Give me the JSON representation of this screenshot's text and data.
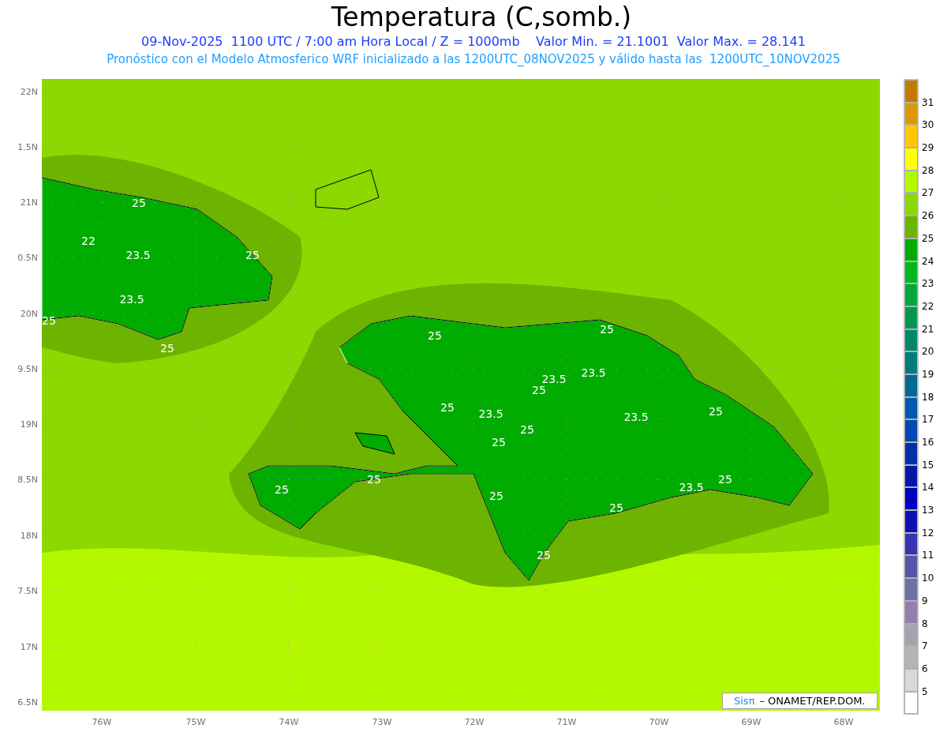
{
  "title": "Temperatura (C,somb.)",
  "subtitle": "09-Nov-2025  1100 UTC / 7:00 am Hora Local / Z = 1000mb    Valor Min. = 21.1001  Valor Max. = 28.141",
  "note": "Pronóstico con el Modelo Atmosferico WRF inicializado a las 1200UTC_08NOV2025 y válido hasta las  1200UTC_10NOV2025",
  "map": {
    "y_labels": [
      "22N",
      "1.5N",
      "21N",
      "0.5N",
      "20N",
      "9.5N",
      "19N",
      "8.5N",
      "18N",
      "7.5N",
      "17N",
      "6.5N"
    ],
    "x_labels": [
      "76W",
      "75W",
      "74W",
      "73W",
      "72W",
      "71W",
      "70W",
      "69W",
      "68W"
    ],
    "contour_labels": [
      "25",
      "22",
      "23.5",
      "25",
      "23.5",
      "25",
      "25",
      "25",
      "25",
      "23.5",
      "23.5",
      "25",
      "25",
      "23.5",
      "23.5",
      "25",
      "25",
      "25",
      "25",
      "25",
      "23.5",
      "25",
      "25",
      "25",
      "25"
    ]
  },
  "credit": {
    "brand": "Sisπ",
    "text": "– ONAMET/REP.DOM."
  },
  "colorbar": {
    "items": [
      {
        "color": "#c07c00"
      },
      {
        "label": "31",
        "color": "#e09800"
      },
      {
        "label": "30",
        "color": "#ffc800"
      },
      {
        "label": "29",
        "color": "#ffff00"
      },
      {
        "label": "28",
        "color": "#b4f800"
      },
      {
        "label": "27",
        "color": "#8cd800"
      },
      {
        "label": "26",
        "color": "#6cb400"
      },
      {
        "label": "25",
        "color": "#00ac00"
      },
      {
        "label": "24",
        "color": "#00b81c"
      },
      {
        "label": "23",
        "color": "#00a83c"
      },
      {
        "label": "22",
        "color": "#009850"
      },
      {
        "label": "21",
        "color": "#008868"
      },
      {
        "label": "20",
        "color": "#007c7c"
      },
      {
        "label": "19",
        "color": "#006898"
      },
      {
        "label": "18",
        "color": "#0058b0"
      },
      {
        "label": "17",
        "color": "#0048b0"
      },
      {
        "label": "16",
        "color": "#0030a8"
      },
      {
        "label": "15",
        "color": "#0018a8"
      },
      {
        "label": "14",
        "color": "#0000c0"
      },
      {
        "label": "13",
        "color": "#1010b0"
      },
      {
        "label": "12",
        "color": "#3434b0"
      },
      {
        "label": "11",
        "color": "#5454a8"
      },
      {
        "label": "10",
        "color": "#7070a8"
      },
      {
        "label": "9",
        "color": "#9080b0"
      },
      {
        "label": "8",
        "color": "#a4a4ac"
      },
      {
        "label": "7",
        "color": "#b4b4b4"
      },
      {
        "label": "6",
        "color": "#d8d8d8"
      },
      {
        "label": "5",
        "color": "#ffffff"
      }
    ]
  }
}
